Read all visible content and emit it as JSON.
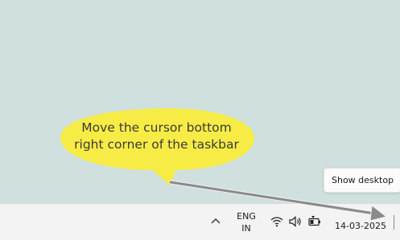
{
  "callout": {
    "text_line1": "Move the cursor bottom",
    "text_line2": "right corner of the taskbar",
    "fill_color": "#f7ec45"
  },
  "tooltip": {
    "label": "Show desktop"
  },
  "taskbar": {
    "language_line1": "ENG",
    "language_line2": "IN",
    "date": "14-03-2025",
    "tray_icons": [
      "chevron-up-icon",
      "wifi-icon",
      "speaker-icon",
      "battery-icon"
    ]
  },
  "arrow": {
    "color": "#8a8a8a"
  }
}
